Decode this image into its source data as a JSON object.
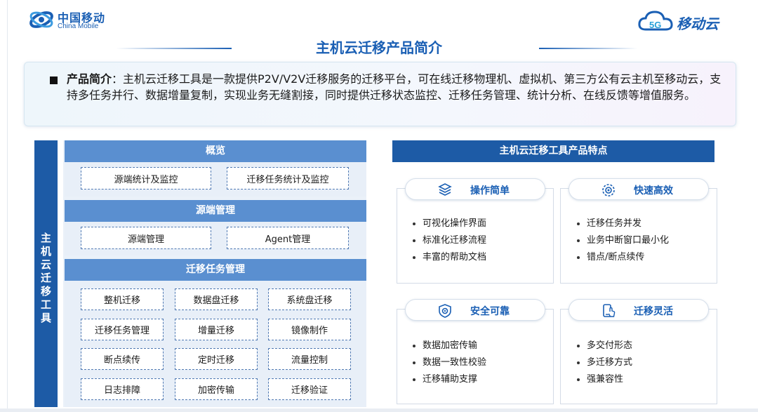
{
  "logos": {
    "china_mobile_cn": "中国移动",
    "china_mobile_en": "China Mobile",
    "mobile_cloud_badge": "5G",
    "mobile_cloud_text": "移动云"
  },
  "title": "主机云迁移产品简介",
  "intro": {
    "label": "产品简介",
    "separator": "：",
    "text": "主机云迁移工具是一款提供P2V/V2V迁移服务的迁移平台，可在线迁移物理机、虚拟机、第三方公有云主机至移动云，支持多任务并行、数据增量复制，实现业务无缝割接，同时提供迁移状态监控、迁移任务管理、统计分析、在线反馈等增值服务。"
  },
  "left_panel": {
    "vertical_label": "主机云迁移工具",
    "sections": [
      {
        "title": "概览",
        "items": [
          "源端统计及监控",
          "迁移任务统计及监控"
        ]
      },
      {
        "title": "源端管理",
        "items": [
          "源端管理",
          "Agent管理"
        ]
      },
      {
        "title": "迁移任务管理",
        "items": [
          "整机迁移",
          "数据盘迁移",
          "系统盘迁移",
          "迁移任务管理",
          "增量迁移",
          "镜像制作",
          "断点续传",
          "定时迁移",
          "流量控制",
          "日志排障",
          "加密传输",
          "迁移验证"
        ]
      }
    ]
  },
  "right_panel": {
    "title": "主机云迁移工具产品特点",
    "cards": [
      {
        "label": "操作简单",
        "icon": "stack-box-icon",
        "items": [
          "可视化操作界面",
          "标准化迁移流程",
          "丰富的帮助文档"
        ]
      },
      {
        "label": "快速高效",
        "icon": "target-gear-icon",
        "items": [
          "迁移任务并发",
          "业务中断窗口最小化",
          "错点/断点续传"
        ]
      },
      {
        "label": "安全可靠",
        "icon": "shield-lock-icon",
        "items": [
          "数据加密传输",
          "数据一致性校验",
          "迁移辅助支撑"
        ]
      },
      {
        "label": "迁移灵活",
        "icon": "mobile-touch-icon",
        "items": [
          "多交付形态",
          "多迁移方式",
          "强兼容性"
        ]
      }
    ]
  },
  "colors": {
    "brand_blue": "#1a5fb4",
    "section_header": "#5a8fd0",
    "dark_header": "#1d5ba6",
    "panel_bg": "#e8eff8"
  }
}
